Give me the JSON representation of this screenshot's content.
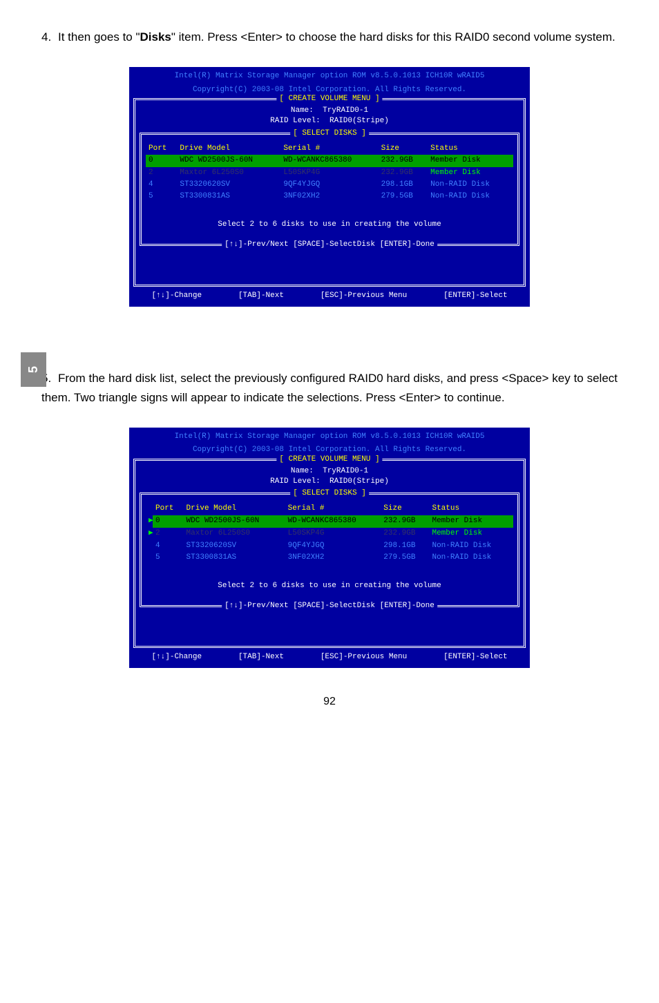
{
  "sideTab": "5",
  "step4": {
    "num": "4.",
    "pre": "It then goes to \"",
    "bold": "Disks",
    "post": "\" item. Press <Enter> to choose the hard disks for this RAID0 second volume system."
  },
  "step5": {
    "num": "5.",
    "text": "From the hard disk list, select the previously configured RAID0 hard disks, and press <Space> key to select them. Two triangle signs will appear to indicate the selections. Press <Enter> to continue."
  },
  "bios": {
    "headerLine1": "Intel(R) Matrix Storage Manager option ROM v8.5.0.1013 ICH10R wRAID5",
    "headerLine2": "Copyright(C) 2003-08 Intel Corporation.   All Rights Reserved.",
    "createMenuLabel": "[ CREATE VOLUME MENU ]",
    "nameLabel": "Name:",
    "nameValue": "TryRAID0-1",
    "raidLabel": "RAID Level:",
    "raidValue": "RAID0(Stripe)",
    "selectDisksLabel": "[ SELECT DISKS ]",
    "headers": {
      "port": "Port",
      "drive": "Drive Model",
      "serial": "Serial #",
      "size": "Size",
      "status": "Status"
    },
    "rows": [
      {
        "port": "0",
        "model": "WDC WD2500JS-60N",
        "serial": "WD-WCANKC865380",
        "size": "232.9GB",
        "status": "Member Disk"
      },
      {
        "port": "2",
        "model": "Maxtor 6L250S0",
        "serial": "L50SKP4G",
        "size": "232.9GB",
        "status": "Member Disk"
      },
      {
        "port": "4",
        "model": "ST3320620SV",
        "serial": "9QF4YJGQ",
        "size": "298.1GB",
        "status": "Non-RAID Disk"
      },
      {
        "port": "5",
        "model": "ST3300831AS",
        "serial": "3NF02XH2",
        "size": "279.5GB",
        "status": "Non-RAID Disk"
      }
    ],
    "selectText": "Select 2 to 6 disks to use in creating the volume",
    "navHelp": "[↑↓]-Prev/Next [SPACE]-SelectDisk [ENTER]-Done",
    "footer": {
      "change": "[↑↓]-Change",
      "tab": "[TAB]-Next",
      "esc": "[ESC]-Previous Menu",
      "enter": "[ENTER]-Select"
    }
  },
  "triangle": "▶",
  "pageNum": "92"
}
